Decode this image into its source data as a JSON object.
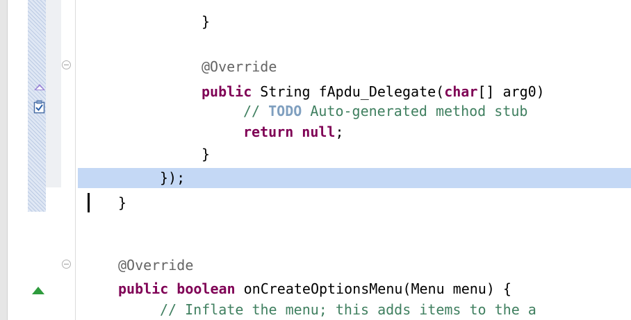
{
  "editor": {
    "lines": [
      {
        "id": "line-brace-1",
        "segments": [
          {
            "t": "}",
            "c": "plain"
          }
        ]
      },
      {
        "id": "line-override-1",
        "segments": [
          {
            "t": "@Override",
            "c": "ann"
          }
        ]
      },
      {
        "id": "line-method-sig",
        "segments": [
          {
            "t": "public",
            "c": "kw"
          },
          {
            "t": " String fApdu_Delegate(",
            "c": "plain"
          },
          {
            "t": "char",
            "c": "kw"
          },
          {
            "t": "[] arg0)",
            "c": "plain"
          }
        ]
      },
      {
        "id": "line-todo-comment",
        "segments": [
          {
            "t": "// ",
            "c": "cmt"
          },
          {
            "t": "TODO",
            "c": "todo"
          },
          {
            "t": " Auto-generated method stub",
            "c": "cmt"
          }
        ]
      },
      {
        "id": "line-return-null",
        "segments": [
          {
            "t": "return",
            "c": "kw"
          },
          {
            "t": " ",
            "c": "plain"
          },
          {
            "t": "null",
            "c": "kw"
          },
          {
            "t": ";",
            "c": "plain"
          }
        ]
      },
      {
        "id": "line-brace-2",
        "segments": [
          {
            "t": "}",
            "c": "plain"
          }
        ]
      },
      {
        "id": "line-close-call",
        "segments": [
          {
            "t": "});",
            "c": "plain"
          }
        ]
      },
      {
        "id": "line-brace-3",
        "segments": [
          {
            "t": "}",
            "c": "plain"
          }
        ]
      },
      {
        "id": "line-override-2",
        "segments": [
          {
            "t": "@Override",
            "c": "ann"
          }
        ]
      },
      {
        "id": "line-menu-sig",
        "segments": [
          {
            "t": "public",
            "c": "kw"
          },
          {
            "t": " ",
            "c": "plain"
          },
          {
            "t": "boolean",
            "c": "kw"
          },
          {
            "t": " onCreateOptionsMenu(Menu menu) {",
            "c": "plain"
          }
        ]
      },
      {
        "id": "line-inflate-comment",
        "segments": [
          {
            "t": "// Inflate the menu; this adds items to the a",
            "c": "cmt"
          }
        ]
      }
    ]
  },
  "gutter": {
    "fold_icons": [
      "collapse-icon",
      "collapse-icon"
    ],
    "markers": [
      "override-marker-icon",
      "task-marker-icon",
      "implements-marker-icon"
    ]
  },
  "colors": {
    "keyword": "#7f0055",
    "annotation": "#646464",
    "comment": "#3f7f5f",
    "todo_tag": "#7f9fbf",
    "current_line_highlight": "#c4d8f5"
  }
}
